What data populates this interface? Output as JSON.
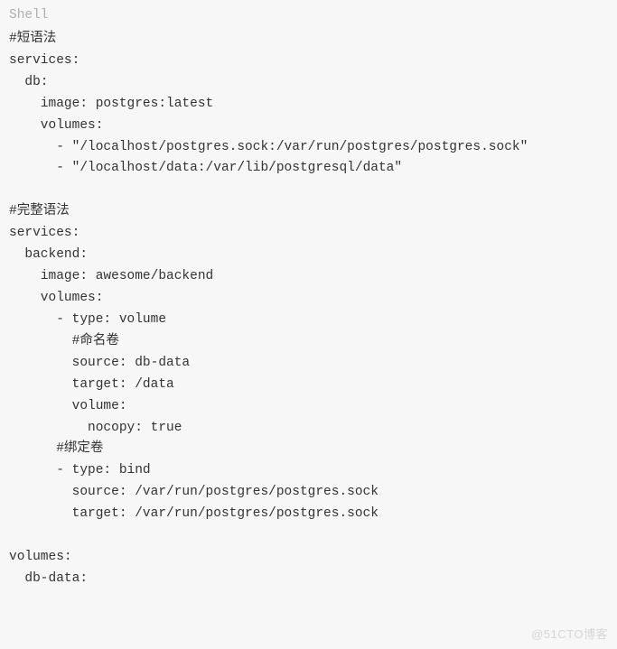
{
  "label": "Shell",
  "code": "#短语法\nservices:\n  db:\n    image: postgres:latest\n    volumes:\n      - \"/localhost/postgres.sock:/var/run/postgres/postgres.sock\"\n      - \"/localhost/data:/var/lib/postgresql/data\"\n\n#完整语法\nservices:\n  backend:\n    image: awesome/backend\n    volumes:\n      - type: volume\n        #命名卷\n        source: db-data\n        target: /data\n        volume:\n          nocopy: true\n      #绑定卷\n      - type: bind\n        source: /var/run/postgres/postgres.sock\n        target: /var/run/postgres/postgres.sock\n\nvolumes:\n  db-data:",
  "watermark": "@51CTO博客"
}
